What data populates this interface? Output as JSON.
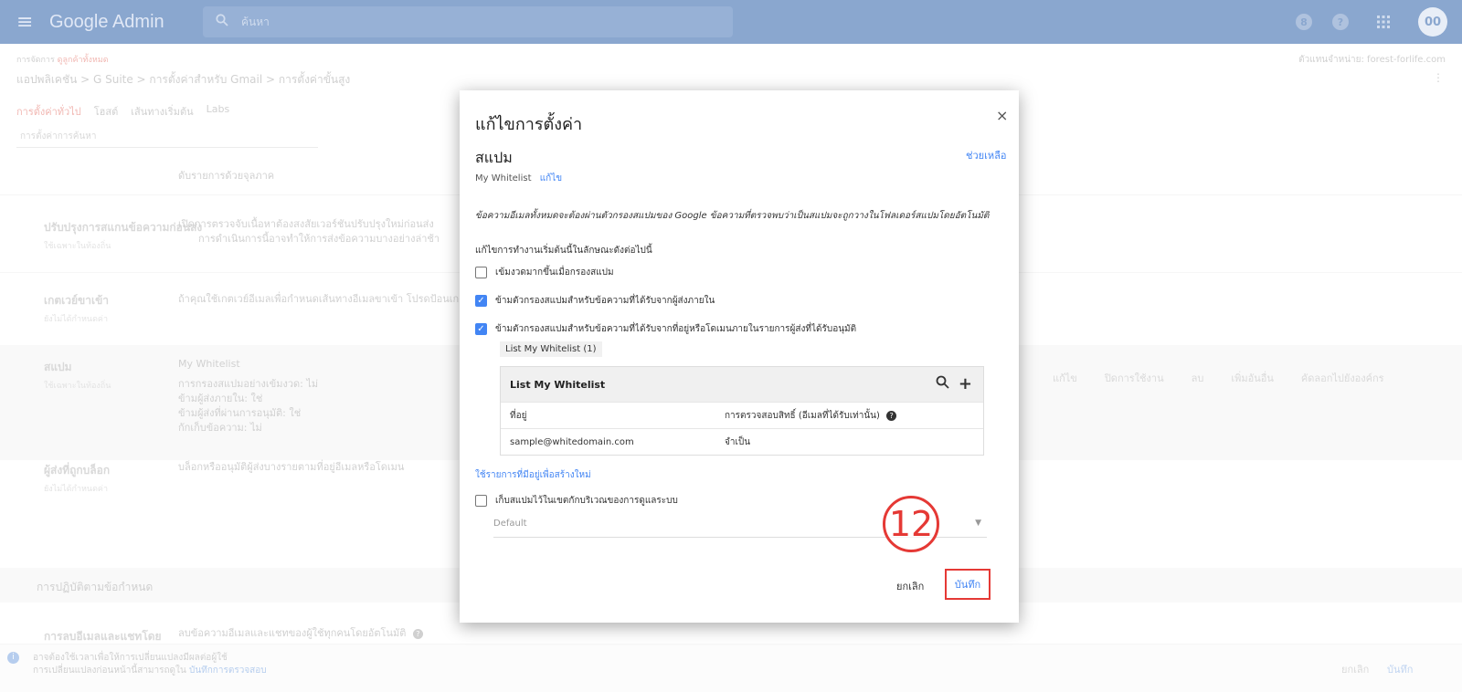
{
  "topbar": {
    "menu_icon": "≡",
    "brand": "Google Admin",
    "search_placeholder": "ค้นหา",
    "avatar_text": "00"
  },
  "breadcrumb": {
    "prefix": "การจัดการ",
    "link": "ดูลูกค้าทั้งหมด",
    "domain": "ตัวแทนจำหน่าย: forest-forlife.com",
    "path": "แอปพลิเคชัน > G Suite > การตั้งค่าสำหรับ Gmail > การตั้งค่าขั้นสูง"
  },
  "tabs": [
    {
      "label": "การตั้งค่าทั่วไป",
      "active": true
    },
    {
      "label": "โฮสต์",
      "active": false
    },
    {
      "label": "เส้นทางเริ่มต้น",
      "active": false
    },
    {
      "label": "Labs",
      "active": false
    }
  ],
  "filter_placeholder": "การตั้งค่าการค้นหา",
  "settings": {
    "org_label": "ดับรายการด้วยจุลภาค",
    "pre_delivery": {
      "title": "ปรับปรุงการสแกนข้อความก่อนส่ง",
      "status": "ใช้เฉพาะในท้องถิ่น",
      "desc_line1": "เปิดการตรวจจับเนื้อหาต้องสงสัยเวอร์ชันปรับปรุงใหม่ก่อนส่ง",
      "desc_line2": "การดำเนินการนี้อาจทำให้การส่งข้อความบางอย่างล่าช้า"
    },
    "inbound_gateway": {
      "title": "เกตเวย์ขาเข้า",
      "status": "ยังไม่ได้กำหนดค่า",
      "desc": "ถ้าคุณใช้เกตเวย์อีเมลเพื่อกำหนดเส้นทางอีเมลขาเข้า โปรดป้อนเกตเวย์"
    },
    "spam": {
      "title": "สแปม",
      "status": "ใช้เฉพาะในท้องถิ่น",
      "whitelist": "My Whitelist",
      "lines": [
        "การกรองสแปมอย่างเข้มงวด: ไม่",
        "ข้ามผู้ส่งภายใน: ใช่",
        "ข้ามผู้ส่งที่ผ่านการอนุมัติ: ใช่",
        "กักเก็บข้อความ: ไม่"
      ],
      "actions": [
        "แก้ไข",
        "ปิดการใช้งาน",
        "ลบ",
        "เพิ่มอันอื่น",
        "คัดลอกไปยังองค์กร"
      ]
    },
    "blocked": {
      "title": "ผู้ส่งที่ถูกบล็อก",
      "status": "ยังไม่ได้กำหนดค่า",
      "desc": "บล็อกหรืออนุมัติผู้ส่งบางรายตามที่อยู่อีเมลหรือโดเมน"
    },
    "compliance_heading": "การปฏิบัติตามข้อกำหนด",
    "email_deletion": {
      "title": "การลบอีเมลและแชทโดย",
      "desc": "ลบข้อความอีเมลและแชทของผู้ใช้ทุกคนโดยอัตโนมัติ"
    }
  },
  "bottom_bar": {
    "info_line1": "อาจต้องใช้เวลาเพื่อให้การเปลี่ยนแปลงมีผลต่อผู้ใช้",
    "info_line2": "การเปลี่ยนแปลงก่อนหน้านี้สามารถดูใน",
    "info_link": "บันทึกการตรวจสอบ",
    "cancel": "ยกเลิก",
    "save": "บันทึก"
  },
  "dialog": {
    "title": "แก้ไขการตั้งค่า",
    "close": "×",
    "heading": "สแปม",
    "help": "ช่วยเหลือ",
    "subtitle": "My Whitelist",
    "subtitle_edit": "แก้ไข",
    "note": "ข้อความอีเมลทั้งหมดจะต้องผ่านตัวกรองสแปมของ Google ข้อความที่ตรวจพบว่าเป็นสแปมจะถูกวางในโฟลเดอร์สแปมโดยอัตโนมัติ",
    "intro": "แก้ไขการทำงานเริ่มต้นนี้ในลักษณะดังต่อไปนี้",
    "options": [
      {
        "label": "เข้มงวดมากขึ้นเมื่อกรองสแปม",
        "checked": false
      },
      {
        "label": "ข้ามตัวกรองสแปมสำหรับข้อความที่ได้รับจากผู้ส่งภายใน",
        "checked": true
      },
      {
        "label": "ข้ามตัวกรองสแปมสำหรับข้อความที่ได้รับจากที่อยู่หรือโดเมนภายในรายการผู้ส่งที่ได้รับอนุมัติ",
        "checked": true
      }
    ],
    "list_chip": "List My Whitelist (1)",
    "table": {
      "title": "List My Whitelist",
      "columns": [
        "ที่อยู่",
        "การตรวจสอบสิทธิ์ (อีเมลที่ได้รับเท่านั้น)"
      ],
      "rows": [
        [
          "sample@whitedomain.com",
          "จำเป็น"
        ]
      ]
    },
    "use_existing": "ใช้รายการที่มีอยู่เพื่อสร้างใหม่",
    "quarantine_label": "เก็บสแปมไว้ในเขตกักบริเวณของการดูแลระบบ",
    "quarantine_checked": false,
    "quarantine_select": "Default",
    "step_number": "12",
    "cancel": "ยกเลิก",
    "save": "บันทึก"
  }
}
